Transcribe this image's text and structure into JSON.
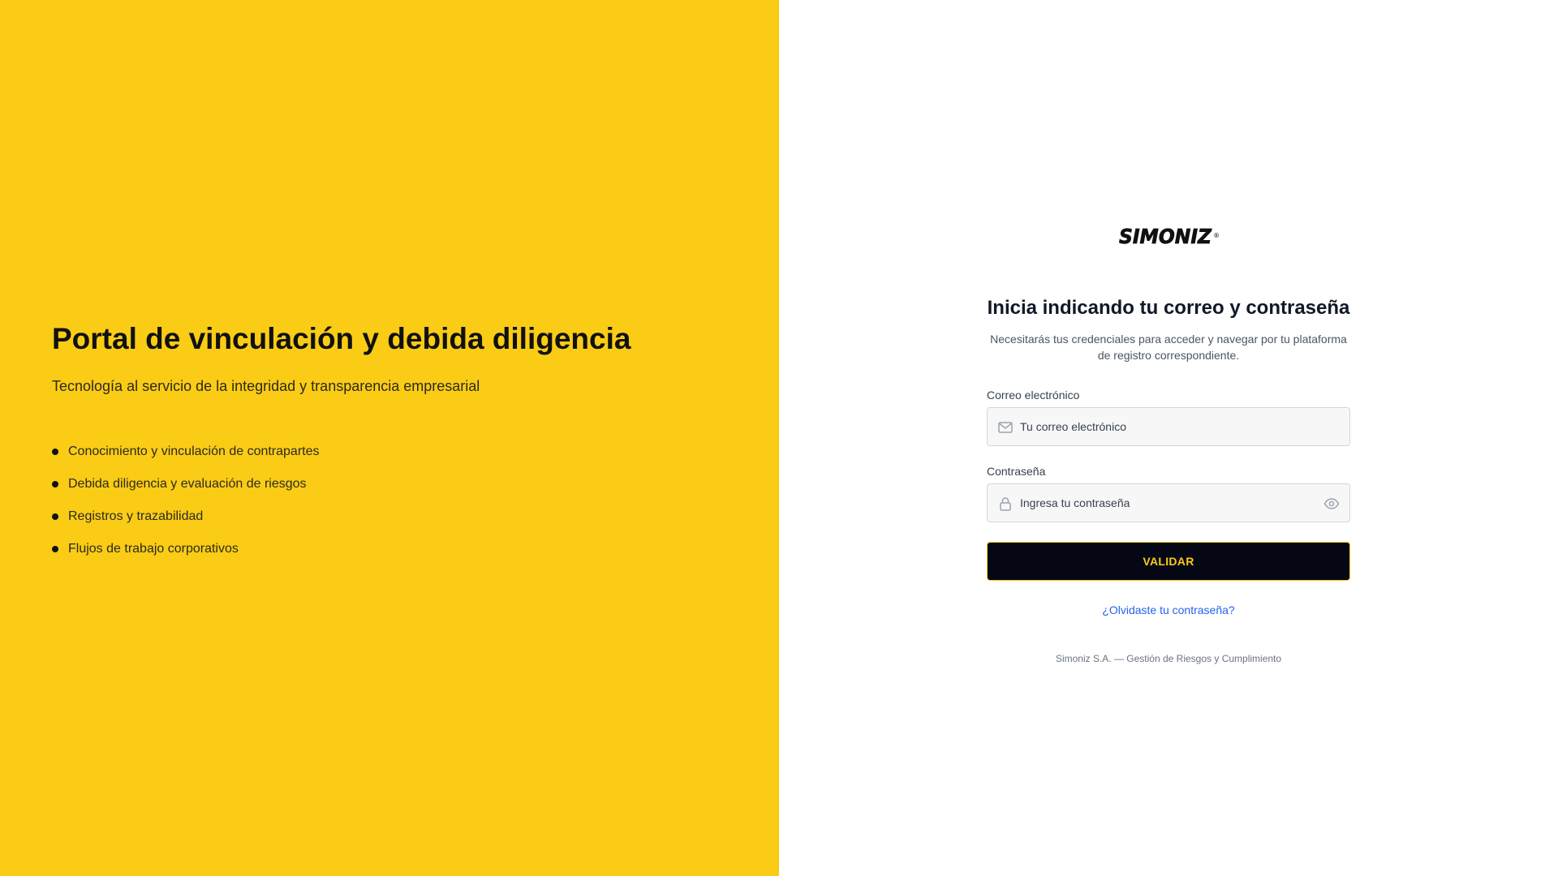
{
  "hero": {
    "title": "Portal de vinculación y debida diligencia",
    "subtitle": "Tecnología al servicio de la integridad y transparencia empresarial",
    "features": [
      "Conocimiento y vinculación de contrapartes",
      "Debida diligencia y evaluación de riesgos",
      "Registros y trazabilidad",
      "Flujos de trabajo corporativos"
    ],
    "background_color": "#facc15"
  },
  "brand": {
    "logo_text": "SIMONIZ",
    "registered_mark": "®"
  },
  "login": {
    "title": "Inicia indicando tu correo y contraseña",
    "description": "Necesitarás tus credenciales para acceder y navegar por tu plataforma de registro correspondiente.",
    "email": {
      "label": "Correo electrónico",
      "placeholder": "Tu correo electrónico",
      "value": "",
      "icon": "mail-icon"
    },
    "password": {
      "label": "Contraseña",
      "placeholder": "Ingresa tu contraseña",
      "value": "",
      "icon": "lock-icon",
      "toggle_icon": "eye-icon"
    },
    "submit_label": "VALIDAR",
    "forgot_link": "¿Olvidaste tu contraseña?",
    "button_color": "#050814",
    "button_text_color": "#facc15",
    "link_color": "#2563eb"
  },
  "footer": {
    "text": "Simoniz S.A. — Gestión de Riesgos y Cumplimiento"
  }
}
